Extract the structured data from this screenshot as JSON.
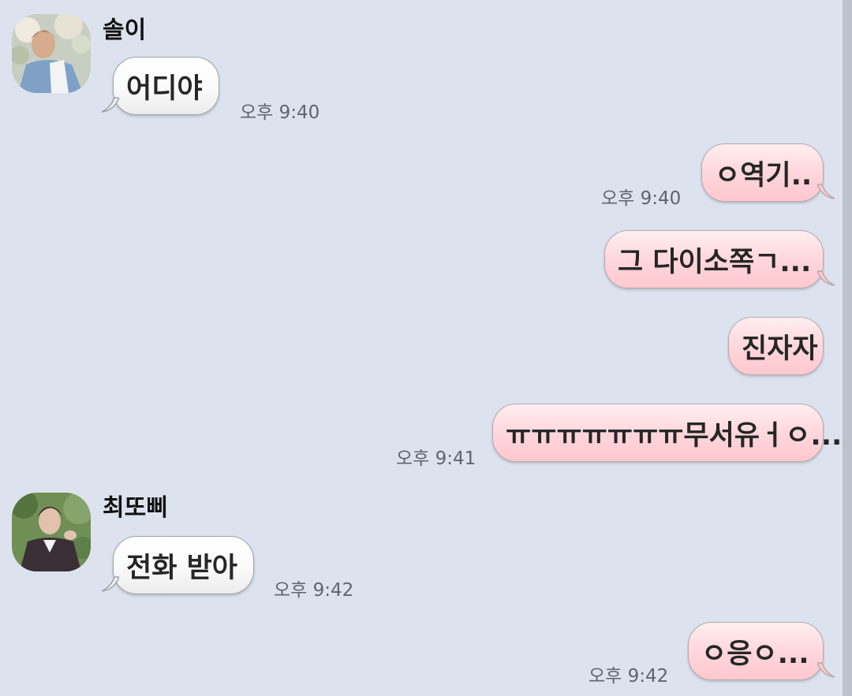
{
  "messages": [
    {
      "sender": "솔이",
      "text": "어디야",
      "time": "오후 9:40"
    },
    {
      "text": "ㅇ역기..",
      "time": "오후 9:40"
    },
    {
      "text": "그 다이소쪽ㄱ..."
    },
    {
      "text": "진자자"
    },
    {
      "text": "ㅠㅠㅠㅠㅠㅠㅠ무서유ㅓㅇ...",
      "time": "오후 9:41"
    },
    {
      "sender": "최또삐",
      "text": "전화 받아",
      "time": "오후 9:42"
    },
    {
      "text": "ㅇ응ㅇ...",
      "time": "오후 9:42"
    }
  ],
  "colors": {
    "background": "#dde3ee",
    "incoming_bubble": "#ffffff",
    "outgoing_bubble": "#ffd5db",
    "timestamp": "#5e6570"
  },
  "icons": {
    "avatar_1": "profile-photo-solyi",
    "avatar_2": "profile-photo-choi"
  }
}
